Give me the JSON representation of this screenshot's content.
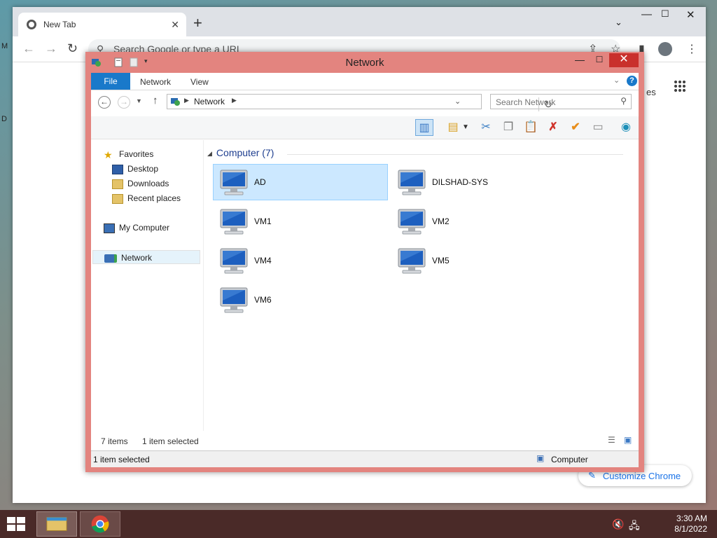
{
  "chrome": {
    "tab_title": "New Tab",
    "omnibox_placeholder": "Search Google or type a URL",
    "partial_label": "es",
    "customize_label": "Customize Chrome"
  },
  "explorer": {
    "title": "Network",
    "ribbon_tabs": [
      "File",
      "Network",
      "View"
    ],
    "breadcrumb": "Network",
    "search_placeholder": "Search Network",
    "nav": {
      "favorites": "Favorites",
      "desktop": "Desktop",
      "downloads": "Downloads",
      "recent": "Recent places",
      "computer": "My Computer",
      "network": "Network"
    },
    "group_header": "Computer (7)",
    "computers": [
      {
        "name": "AD",
        "selected": true
      },
      {
        "name": "DILSHAD-SYS",
        "selected": false
      },
      {
        "name": "VM1",
        "selected": false
      },
      {
        "name": "VM2",
        "selected": false
      },
      {
        "name": "VM4",
        "selected": false
      },
      {
        "name": "VM5",
        "selected": false
      },
      {
        "name": "VM6",
        "selected": false
      }
    ],
    "status": {
      "items_count": "7 items",
      "selected": "1 item selected",
      "bottom_left": "1 item selected",
      "bottom_right": "Computer"
    }
  },
  "taskbar": {
    "time": "3:30 AM",
    "date": "8/1/2022"
  },
  "colors": {
    "explorer_frame": "#e3847f",
    "accent": "#1979ca",
    "selection": "#cce8ff",
    "taskbar": "#4a2a28"
  }
}
